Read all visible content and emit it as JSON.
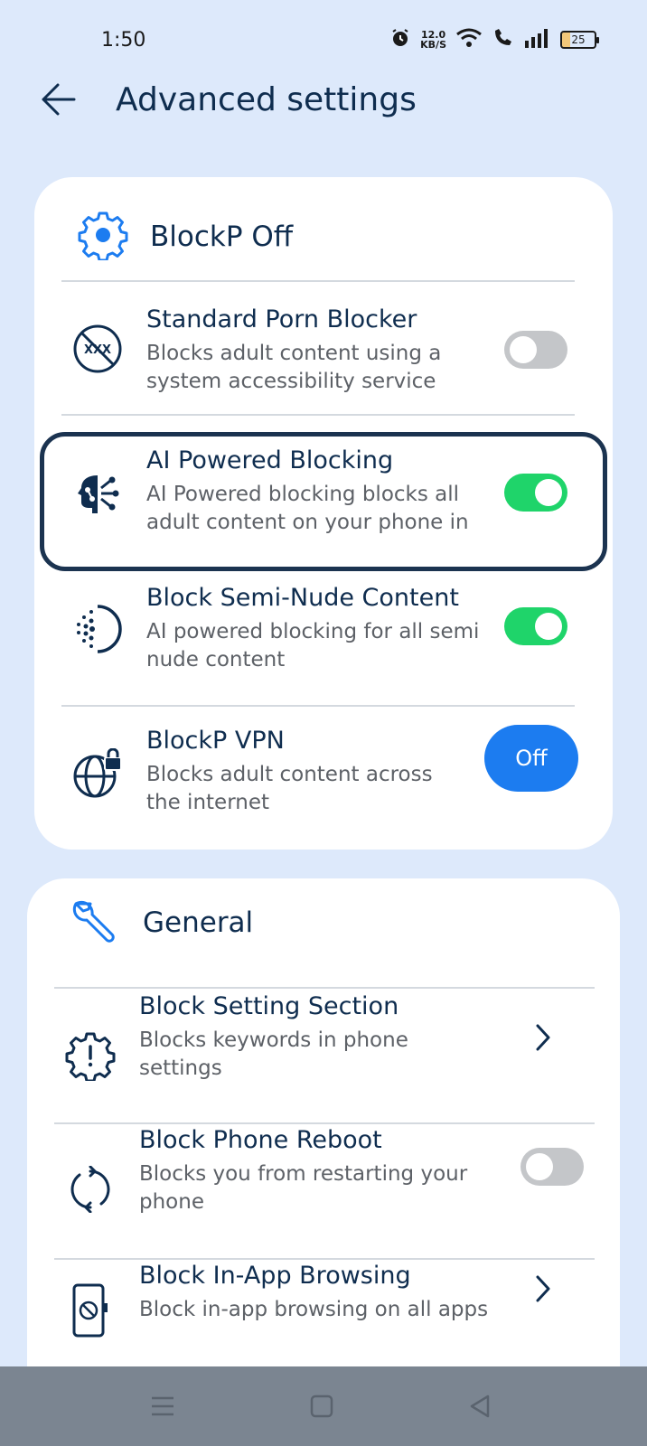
{
  "status_bar": {
    "time": "1:50",
    "net_speed_value": "12.0",
    "net_speed_unit": "KB/S",
    "battery_level": "25"
  },
  "header": {
    "title": "Advanced settings",
    "back_icon": "arrow-left-icon"
  },
  "blockp_section": {
    "title": "BlockP Off",
    "icon": "gear-icon",
    "items": [
      {
        "title": "Standard Porn Blocker",
        "description": "Blocks adult content using a system accessibility service",
        "icon": "xxx-blocked-icon",
        "control": "toggle",
        "enabled": false
      },
      {
        "title": "AI Powered Blocking",
        "description": "AI Powered blocking blocks all adult content on your phone in",
        "icon": "ai-brain-icon",
        "control": "toggle",
        "enabled": true,
        "highlighted": true
      },
      {
        "title": "Block Semi-Nude Content",
        "description": "AI powered blocking for all semi nude content",
        "icon": "dotted-half-circle-icon",
        "control": "toggle",
        "enabled": true
      },
      {
        "title": "BlockP VPN",
        "description": "Blocks adult content across the internet",
        "icon": "globe-lock-icon",
        "control": "button",
        "button_label": "Off"
      }
    ]
  },
  "general_section": {
    "title": "General",
    "icon": "wrench-icon",
    "items": [
      {
        "title": "Block Setting Section",
        "description": "Blocks keywords in phone settings",
        "icon": "gear-alert-icon",
        "control": "chevron"
      },
      {
        "title": "Block Phone Reboot",
        "description": "Blocks you from restarting your phone",
        "icon": "reboot-icon",
        "control": "toggle",
        "enabled": false
      },
      {
        "title": "Block In-App Browsing",
        "description": "Block in-app browsing on all apps",
        "icon": "phone-block-icon",
        "control": "chevron"
      }
    ]
  },
  "nav_bar": {
    "icons": [
      "menu-icon",
      "home-square-icon",
      "back-triangle-icon"
    ]
  },
  "colors": {
    "background": "#dde9fb",
    "card": "#ffffff",
    "title_text": "#0f2d4f",
    "toggle_on": "#1fd46a",
    "toggle_off": "#c4c6c9",
    "vpn_button": "#1c7cf0",
    "highlight_border": "#1b3350",
    "accent_icon": "#1c7cf0"
  }
}
